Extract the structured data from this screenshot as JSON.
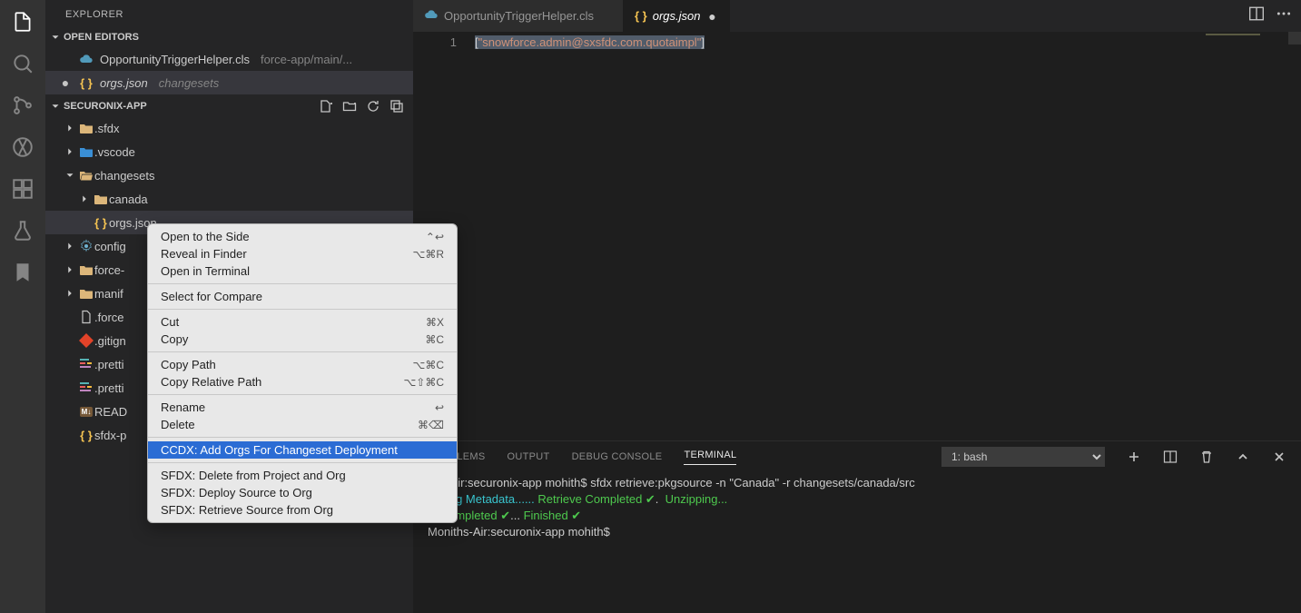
{
  "sidebar": {
    "title": "EXPLORER",
    "openEditorsLabel": "OPEN EDITORS",
    "projectLabel": "SECURONIX-APP",
    "openEditors": [
      {
        "name": "OpportunityTriggerHelper.cls",
        "path": "force-app/main/...",
        "iconColor": "#519aba",
        "modified": false,
        "active": false
      },
      {
        "name": "orgs.json",
        "path": "changesets",
        "iconColor": "#f6c452",
        "modified": true,
        "active": true,
        "italic": true
      }
    ],
    "tree": [
      {
        "depth": 0,
        "type": "folder",
        "label": ".sfdx",
        "expanded": false
      },
      {
        "depth": 0,
        "type": "folder-vscode",
        "label": ".vscode",
        "expanded": false
      },
      {
        "depth": 0,
        "type": "folder",
        "label": "changesets",
        "expanded": true
      },
      {
        "depth": 1,
        "type": "folder",
        "label": "canada",
        "expanded": false
      },
      {
        "depth": 1,
        "type": "json",
        "label": "orgs.json",
        "selected": true
      },
      {
        "depth": 0,
        "type": "file-gear",
        "label": "config"
      },
      {
        "depth": 0,
        "type": "folder",
        "label": "force-"
      },
      {
        "depth": 0,
        "type": "folder",
        "label": "manif"
      },
      {
        "depth": 0,
        "type": "file",
        "label": ".force"
      },
      {
        "depth": 0,
        "type": "file-git",
        "label": ".gitign"
      },
      {
        "depth": 0,
        "type": "file-prettier",
        "label": ".pretti"
      },
      {
        "depth": 0,
        "type": "file-prettier",
        "label": ".pretti"
      },
      {
        "depth": 0,
        "type": "file-md",
        "label": "READ"
      },
      {
        "depth": 0,
        "type": "json",
        "label": "sfdx-p"
      }
    ]
  },
  "tabs": [
    {
      "label": "OpportunityTriggerHelper.cls",
      "icon": "cloud",
      "active": false
    },
    {
      "label": "orgs.json",
      "icon": "json",
      "active": true,
      "dirty": true,
      "italic": true
    }
  ],
  "editor": {
    "lineNumber": "1",
    "code": {
      "open": "[",
      "string": "\"snowforce.admin@sxsfdc.com.quotaimpl\"",
      "close": "]"
    }
  },
  "panel": {
    "tabs": [
      "PROBLEMS",
      "OUTPUT",
      "DEBUG CONSOLE",
      "TERMINAL"
    ],
    "activeTab": "TERMINAL",
    "terminalSelector": "1: bash",
    "terminalLines": [
      {
        "prompt": "iths-Air:securonix-app mohith$ ",
        "cmd": "sfdx retrieve:pkgsource -n \"Canada\" -r changesets/canada/src"
      },
      {
        "textA": "rieving Metadata...... ",
        "greenA": "Retrieve Completed ✔",
        "textB": ".  ",
        "greenB": "Unzipping..."
      },
      {
        "textA": "ip Completed ✔",
        "textB": "... ",
        "greenA": "Finished ✔"
      },
      {
        "prompt": "Moniths-Air:securonix-app mohith$ "
      }
    ]
  },
  "contextMenu": {
    "items": [
      {
        "label": "Open to the Side",
        "shortcut": "⌃↩"
      },
      {
        "label": "Reveal in Finder",
        "shortcut": "⌥⌘R"
      },
      {
        "label": "Open in Terminal"
      },
      {
        "sep": true
      },
      {
        "label": "Select for Compare"
      },
      {
        "sep": true
      },
      {
        "label": "Cut",
        "shortcut": "⌘X"
      },
      {
        "label": "Copy",
        "shortcut": "⌘C"
      },
      {
        "sep": true
      },
      {
        "label": "Copy Path",
        "shortcut": "⌥⌘C"
      },
      {
        "label": "Copy Relative Path",
        "shortcut": "⌥⇧⌘C"
      },
      {
        "sep": true
      },
      {
        "label": "Rename",
        "shortcut": "↩"
      },
      {
        "label": "Delete",
        "shortcut": "⌘⌫"
      },
      {
        "sep": true
      },
      {
        "label": "CCDX: Add Orgs For Changeset Deployment",
        "selected": true
      },
      {
        "sep": true
      },
      {
        "label": "SFDX: Delete from Project and Org"
      },
      {
        "label": "SFDX: Deploy Source to Org"
      },
      {
        "label": "SFDX: Retrieve Source from Org"
      }
    ]
  }
}
